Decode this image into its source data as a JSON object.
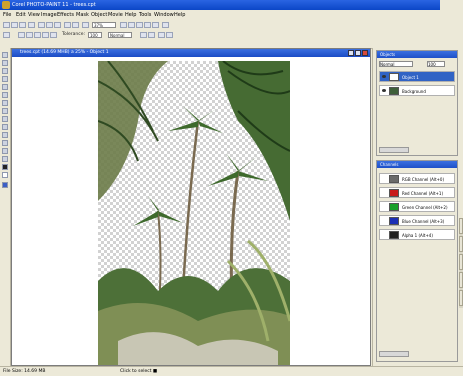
{
  "app": {
    "title": "Corel PHOTO-PAINT 11 - trees.cpt"
  },
  "menu": [
    "File",
    "Edit",
    "View",
    "Image",
    "Effects",
    "Mask",
    "Object",
    "Movie",
    "Help",
    "Tools",
    "Window",
    "Help"
  ],
  "toolbar1": {
    "zoom": "37%"
  },
  "toolbar2": {
    "tolerance_label": "Tolerance:",
    "tolerance_value": "100",
    "mode": "Normal"
  },
  "document": {
    "title": "trees.cpt (14.69 MHB) a 25% - Object 1"
  },
  "objects_panel": {
    "title": "Objects",
    "mode": "Normal",
    "opacity": "100",
    "items": [
      {
        "label": "Object 1",
        "selected": true
      },
      {
        "label": "Background",
        "selected": false
      }
    ]
  },
  "channels_panel": {
    "title": "Channels",
    "items": [
      {
        "label": "RGB Channel (Alt+0)",
        "color": "#6a6a6a"
      },
      {
        "label": "Red Channel (Alt+1)",
        "color": "#c81a1a"
      },
      {
        "label": "Green Channel (Alt+2)",
        "color": "#19a02a"
      },
      {
        "label": "Blue Channel (Alt+3)",
        "color": "#1c2fb5"
      },
      {
        "label": "Alpha 1 (Alt+4)",
        "color": "#222222"
      }
    ]
  },
  "status": {
    "left": "File Size: 14.69 MB",
    "center": "Click to select ■"
  }
}
